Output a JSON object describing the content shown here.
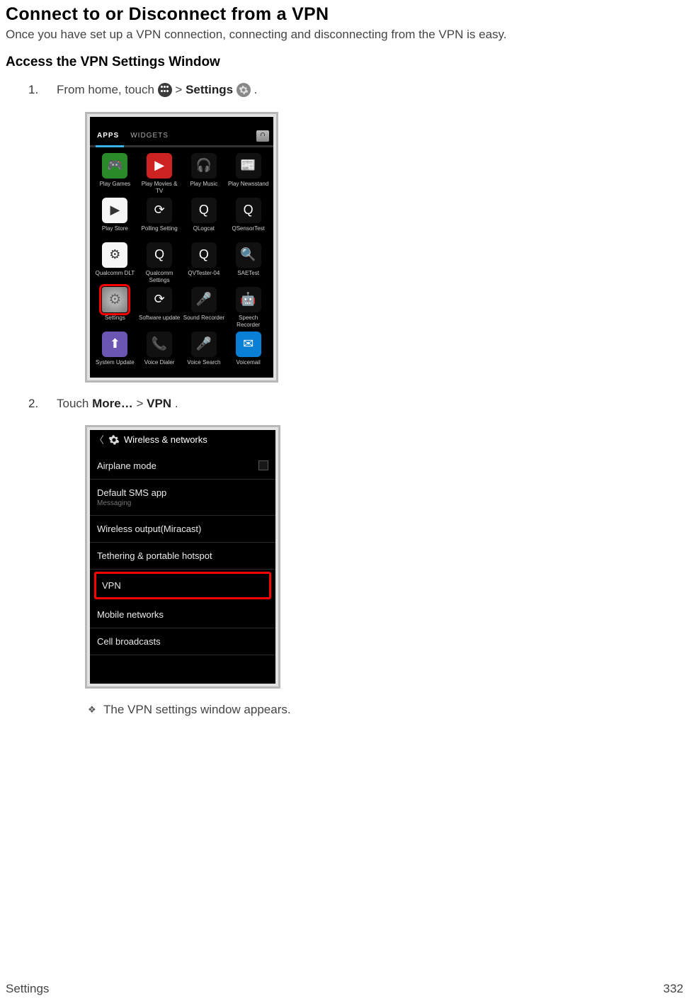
{
  "title": "Connect to or Disconnect from a VPN",
  "intro": "Once you have set up a VPN connection, connecting and disconnecting from the VPN is easy.",
  "subheading": "Access the VPN Settings Window",
  "steps": {
    "s1_pre": "From home, touch ",
    "s1_post_gt": " > ",
    "s1_settings": "Settings",
    "s1_period": ".",
    "s2_pre": "Touch ",
    "s2_more": "More…",
    "s2_gt": " > ",
    "s2_vpn": "VPN",
    "s2_period": "."
  },
  "drawer": {
    "tab_apps": "APPS",
    "tab_widgets": "WIDGETS",
    "apps": [
      {
        "label": "Play Games",
        "class": "ic-green",
        "glyph": "🎮"
      },
      {
        "label": "Play Movies & TV",
        "class": "ic-red",
        "glyph": "▶"
      },
      {
        "label": "Play Music",
        "class": "ic-black",
        "glyph": "🎧"
      },
      {
        "label": "Play Newsstand",
        "class": "ic-black",
        "glyph": "📰"
      },
      {
        "label": "Play Store",
        "class": "ic-white",
        "glyph": "▶"
      },
      {
        "label": "Polling Setting",
        "class": "ic-black",
        "glyph": "⟳"
      },
      {
        "label": "QLogcat",
        "class": "ic-black",
        "glyph": "Q"
      },
      {
        "label": "QSensorTest",
        "class": "ic-black",
        "glyph": "Q"
      },
      {
        "label": "Qualcomm DLT",
        "class": "ic-white",
        "glyph": "⚙"
      },
      {
        "label": "Qualcomm Settings",
        "class": "ic-black",
        "glyph": "Q"
      },
      {
        "label": "QVTester-04",
        "class": "ic-black",
        "glyph": "Q"
      },
      {
        "label": "SAETest",
        "class": "ic-black",
        "glyph": "🔍"
      },
      {
        "label": "Settings",
        "class": "ic-gear-big",
        "glyph": "⚙",
        "highlight": true
      },
      {
        "label": "Software update",
        "class": "ic-black",
        "glyph": "⟳"
      },
      {
        "label": "Sound Recorder",
        "class": "ic-black",
        "glyph": "🎤"
      },
      {
        "label": "Speech Recorder",
        "class": "ic-black",
        "glyph": "🤖"
      },
      {
        "label": "System Update",
        "class": "ic-purple",
        "glyph": "⬆"
      },
      {
        "label": "Voice Dialer",
        "class": "ic-black",
        "glyph": "📞"
      },
      {
        "label": "Voice Search",
        "class": "ic-black",
        "glyph": "🎤"
      },
      {
        "label": "Voicemail",
        "class": "ic-blue",
        "glyph": "✉"
      }
    ]
  },
  "wireless": {
    "title": "Wireless & networks",
    "items": [
      {
        "label": "Airplane mode",
        "checkbox": true
      },
      {
        "label": "Default SMS app",
        "sub": "Messaging"
      },
      {
        "label": "Wireless output(Miracast)"
      },
      {
        "label": "Tethering & portable hotspot"
      },
      {
        "label": "VPN",
        "highlight": true
      },
      {
        "label": "Mobile networks"
      },
      {
        "label": "Cell broadcasts"
      }
    ]
  },
  "result": "The VPN settings window appears.",
  "footer_left": "Settings",
  "footer_right": "332"
}
